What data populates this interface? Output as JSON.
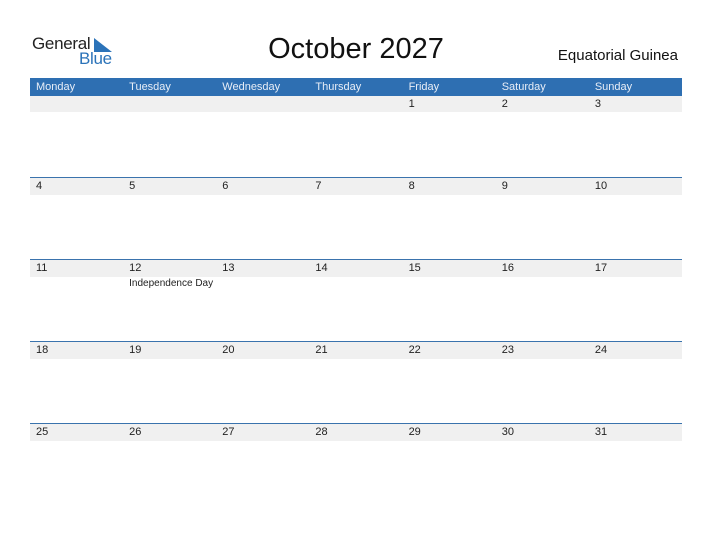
{
  "logo": {
    "general": "General",
    "blue": "Blue",
    "accent": "#2b73b9"
  },
  "title": "October 2027",
  "country": "Equatorial Guinea",
  "colors": {
    "header_bg": "#2e6fb2",
    "row_bg": "#f0f0f0"
  },
  "weekdays": [
    "Monday",
    "Tuesday",
    "Wednesday",
    "Thursday",
    "Friday",
    "Saturday",
    "Sunday"
  ],
  "weeks": [
    {
      "days": [
        "",
        "",
        "",
        "",
        "1",
        "2",
        "3"
      ],
      "holidays": [
        "",
        "",
        "",
        "",
        "",
        "",
        ""
      ]
    },
    {
      "days": [
        "4",
        "5",
        "6",
        "7",
        "8",
        "9",
        "10"
      ],
      "holidays": [
        "",
        "",
        "",
        "",
        "",
        "",
        ""
      ]
    },
    {
      "days": [
        "11",
        "12",
        "13",
        "14",
        "15",
        "16",
        "17"
      ],
      "holidays": [
        "",
        "Independence Day",
        "",
        "",
        "",
        "",
        ""
      ]
    },
    {
      "days": [
        "18",
        "19",
        "20",
        "21",
        "22",
        "23",
        "24"
      ],
      "holidays": [
        "",
        "",
        "",
        "",
        "",
        "",
        ""
      ]
    },
    {
      "days": [
        "25",
        "26",
        "27",
        "28",
        "29",
        "30",
        "31"
      ],
      "holidays": [
        "",
        "",
        "",
        "",
        "",
        "",
        ""
      ]
    }
  ]
}
